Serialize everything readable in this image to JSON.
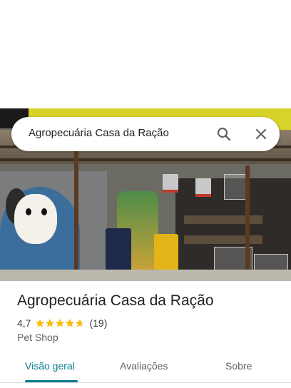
{
  "search": {
    "query": "Agropecuária Casa da Ração"
  },
  "place": {
    "name": "Agropecuária Casa da Ração",
    "rating": "4,7",
    "rating_value": 4.7,
    "review_count": "(19)",
    "category": "Pet Shop"
  },
  "tabs": [
    {
      "label": "Visão geral",
      "active": true
    },
    {
      "label": "Avaliações",
      "active": false
    },
    {
      "label": "Sobre",
      "active": false
    }
  ],
  "colors": {
    "accent": "#0b7c8b",
    "star": "#fbbc04",
    "star_empty": "#dadce0"
  },
  "icons": {
    "search": "search-icon",
    "close": "close-icon",
    "star": "star-icon"
  }
}
